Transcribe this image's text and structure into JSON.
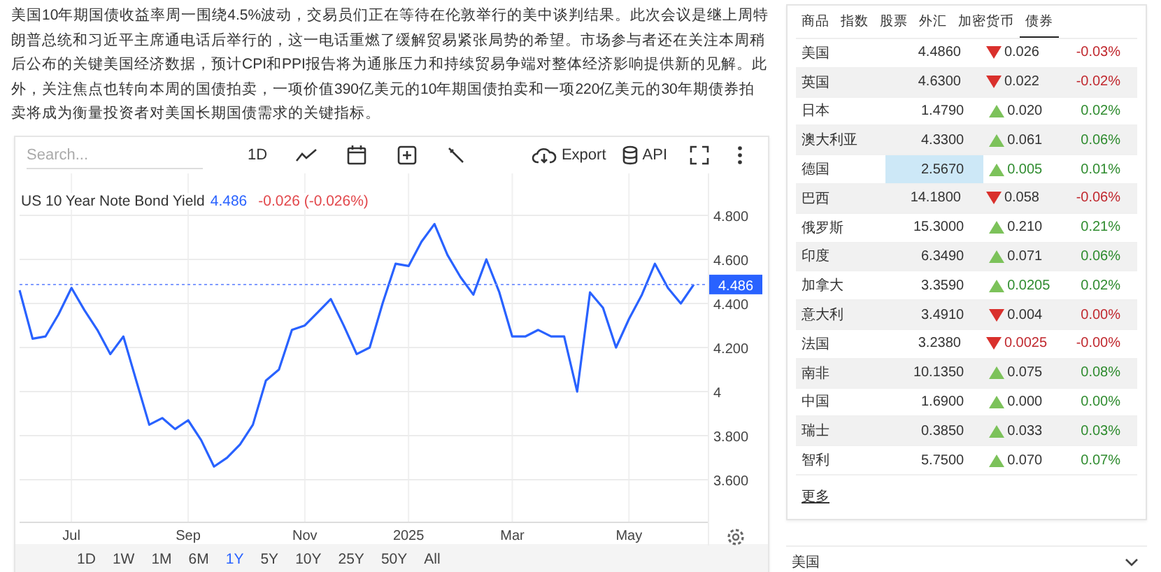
{
  "article": {
    "text": "美国10年期国债收益率周一围绕4.5%波动，交易员们正在等待在伦敦举行的美中谈判结果。此次会议是继上周特朗普总统和习近平主席通电话后举行的，这一电话重燃了缓解贸易紧张局势的希望。市场参与者还在关注本周稍后公布的关键美国经济数据，预计CPI和PPI报告将为通胀压力和持续贸易争端对整体经济影响提供新的见解。此外，关注焦点也转向本周的国债拍卖，一项价值390亿美元的10年期国债拍卖和一项220亿美元的30年期债券拍卖将成为衡量投资者对美国长期国债需求的关键指标。"
  },
  "chart_panel": {
    "search": {
      "placeholder": "Search..."
    },
    "interval": "1D",
    "export": "Export",
    "api": "API",
    "legend": {
      "value": "4.486",
      "change": "-0.026 (-0.026%)"
    },
    "chart_data": {
      "type": "line",
      "categories": [
        null,
        null,
        null,
        null,
        "Jul",
        null,
        null,
        null,
        null,
        null,
        null,
        null,
        null,
        "Sep",
        null,
        null,
        null,
        null,
        null,
        null,
        null,
        null,
        "Nov",
        null,
        null,
        null,
        null,
        null,
        null,
        null,
        "2025",
        null,
        null,
        null,
        null,
        null,
        null,
        null,
        "Mar",
        null,
        null,
        null,
        null,
        null,
        null,
        null,
        null,
        "May",
        null,
        null,
        null,
        null,
        null
      ],
      "series": [
        {
          "name": "US 10 Year Note Bond Yield",
          "color": "#2962ff",
          "values": [
            4.46,
            4.24,
            4.25,
            4.35,
            4.47,
            4.37,
            4.28,
            4.17,
            4.25,
            4.05,
            3.85,
            3.88,
            3.83,
            3.87,
            3.78,
            3.66,
            3.7,
            3.76,
            3.85,
            4.05,
            4.1,
            4.28,
            4.3,
            4.36,
            4.42,
            4.3,
            4.17,
            4.2,
            4.4,
            4.58,
            4.57,
            4.68,
            4.76,
            4.62,
            4.52,
            4.44,
            4.6,
            4.45,
            4.25,
            4.25,
            4.28,
            4.25,
            4.25,
            4.0,
            4.45,
            4.38,
            4.2,
            4.33,
            4.44,
            4.58,
            4.47,
            4.4,
            4.486
          ]
        }
      ],
      "ylim": [
        3.41,
        4.99
      ],
      "grid": true,
      "ref_lines": [
        {
          "axis": "y",
          "value": 4.486,
          "label": "4.486"
        }
      ],
      "yticks": [
        {
          "value": 3.6,
          "label": "3.600"
        },
        {
          "value": 3.8,
          "label": "3.800"
        },
        {
          "value": 4.0,
          "label": "4"
        },
        {
          "value": 4.2,
          "label": "4.200"
        },
        {
          "value": 4.4,
          "label": "4.400"
        },
        {
          "value": 4.6,
          "label": "4.600"
        },
        {
          "value": 4.8,
          "label": "4.800"
        }
      ]
    },
    "ranges": [
      {
        "label": "1D",
        "selected": false
      },
      {
        "label": "1W",
        "selected": false
      },
      {
        "label": "1M",
        "selected": false
      },
      {
        "label": "6M",
        "selected": false
      },
      {
        "label": "1Y",
        "selected": true
      },
      {
        "label": "5Y",
        "selected": false
      },
      {
        "label": "10Y",
        "selected": false
      },
      {
        "label": "25Y",
        "selected": false
      },
      {
        "label": "50Y",
        "selected": false
      },
      {
        "label": "All",
        "selected": false
      }
    ]
  },
  "markets": {
    "tabs": [
      {
        "label": "商品",
        "selected": false
      },
      {
        "label": "指数",
        "selected": false
      },
      {
        "label": "股票",
        "selected": false
      },
      {
        "label": "外汇",
        "selected": false
      },
      {
        "label": "加密货币",
        "selected": false
      },
      {
        "label": "债券",
        "selected": true
      }
    ],
    "rows": [
      {
        "name": "美国",
        "value": "4.4860",
        "change": "0.026",
        "pct": "-0.03%",
        "kind": "down",
        "change_colored": false,
        "value_highlighted": false
      },
      {
        "name": "英国",
        "value": "4.6300",
        "change": "0.022",
        "pct": "-0.02%",
        "kind": "down",
        "change_colored": false,
        "value_highlighted": false
      },
      {
        "name": "日本",
        "value": "1.4790",
        "change": "0.020",
        "pct": "0.02%",
        "kind": "up",
        "change_colored": false,
        "value_highlighted": false
      },
      {
        "name": "澳大利亚",
        "value": "4.3300",
        "change": "0.061",
        "pct": "0.06%",
        "kind": "up",
        "change_colored": false,
        "value_highlighted": false
      },
      {
        "name": "德国",
        "value": "2.5670",
        "change": "0.005",
        "pct": "0.01%",
        "kind": "up",
        "change_colored": true,
        "value_highlighted": true
      },
      {
        "name": "巴西",
        "value": "14.1800",
        "change": "0.058",
        "pct": "-0.06%",
        "kind": "down",
        "change_colored": false,
        "value_highlighted": false
      },
      {
        "name": "俄罗斯",
        "value": "15.3000",
        "change": "0.210",
        "pct": "0.21%",
        "kind": "up",
        "change_colored": false,
        "value_highlighted": false
      },
      {
        "name": "印度",
        "value": "6.3490",
        "change": "0.071",
        "pct": "0.06%",
        "kind": "up",
        "change_colored": false,
        "value_highlighted": false
      },
      {
        "name": "加拿大",
        "value": "3.3590",
        "change": "0.0205",
        "pct": "0.02%",
        "kind": "up",
        "change_colored": true,
        "value_highlighted": false
      },
      {
        "name": "意大利",
        "value": "3.4910",
        "change": "0.004",
        "pct": "0.00%",
        "kind": "down",
        "change_colored": false,
        "value_highlighted": false
      },
      {
        "name": "法国",
        "value": "3.2380",
        "change": "0.0025",
        "pct": "-0.00%",
        "kind": "down",
        "change_colored": true,
        "value_highlighted": false
      },
      {
        "name": "南非",
        "value": "10.1350",
        "change": "0.075",
        "pct": "0.08%",
        "kind": "up",
        "change_colored": false,
        "value_highlighted": false
      },
      {
        "name": "中国",
        "value": "1.6900",
        "change": "0.000",
        "pct": "0.00%",
        "kind": "up",
        "change_colored": false,
        "value_highlighted": false
      },
      {
        "name": "瑞士",
        "value": "0.3850",
        "change": "0.033",
        "pct": "0.03%",
        "kind": "up",
        "change_colored": false,
        "value_highlighted": false
      },
      {
        "name": "智利",
        "value": "5.7500",
        "change": "0.070",
        "pct": "0.07%",
        "kind": "up",
        "change_colored": false,
        "value_highlighted": false
      }
    ],
    "more_link": "更多"
  },
  "accordion": {
    "label": "美国",
    "expanded": false
  }
}
